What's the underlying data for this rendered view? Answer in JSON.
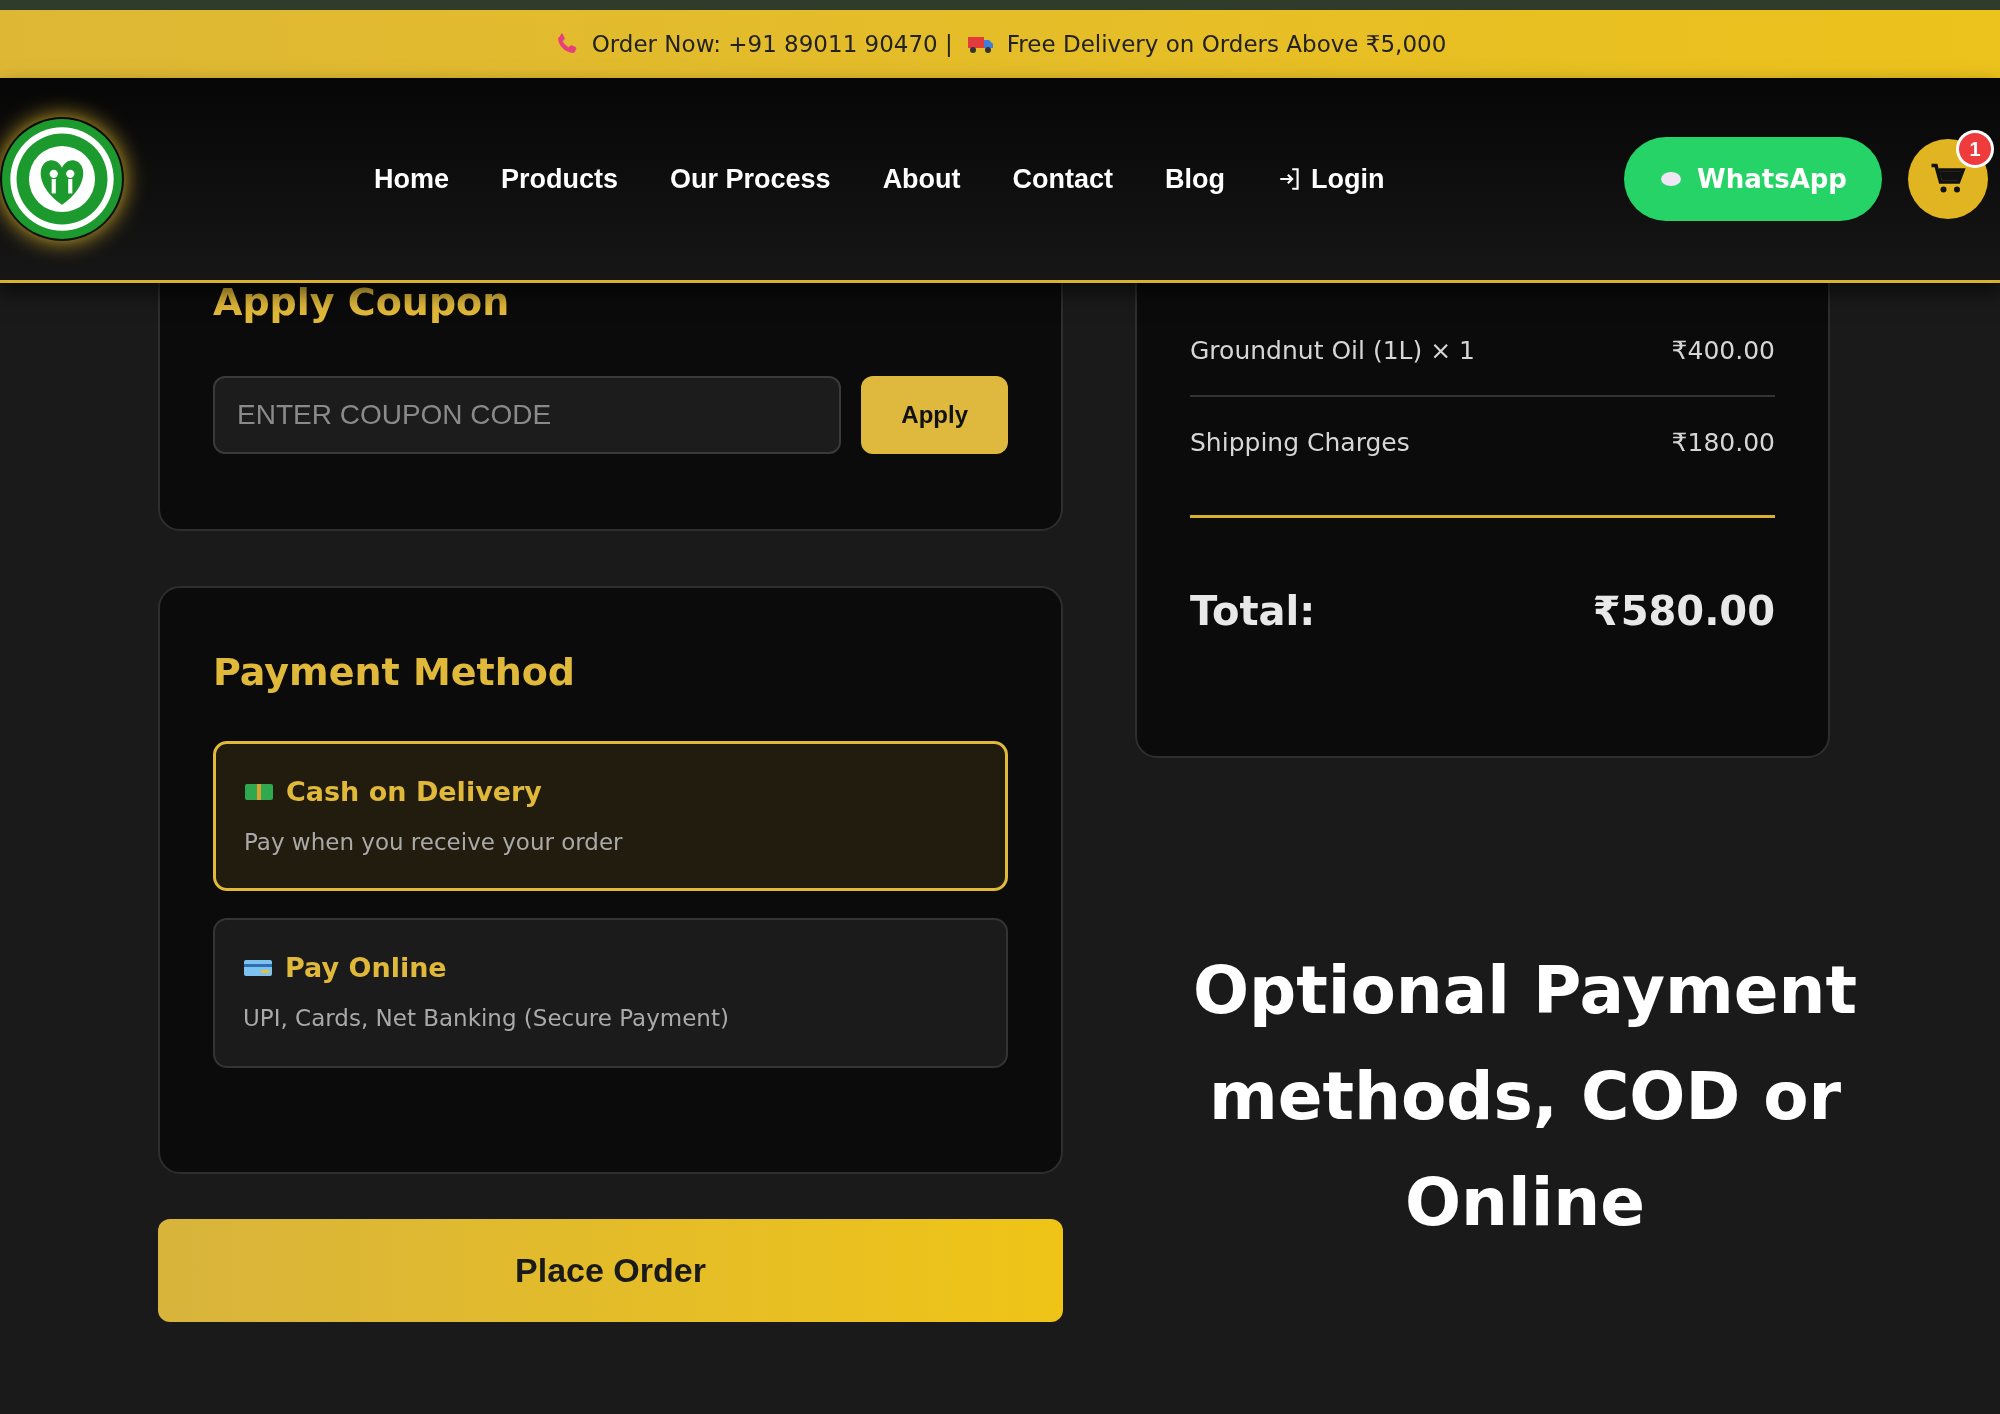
{
  "top_bar": {
    "items": [
      {
        "kind": "phone",
        "text": "Order Now: +91 89011 90470 |"
      },
      {
        "kind": "truck",
        "text": "Free Delivery on Orders Above ₹5,000"
      }
    ]
  },
  "header": {
    "nav": [
      {
        "kind": "link",
        "label": "Home"
      },
      {
        "kind": "link",
        "label": "Products"
      },
      {
        "kind": "link",
        "label": "Our Process"
      },
      {
        "kind": "link",
        "label": "About"
      },
      {
        "kind": "link",
        "label": "Contact"
      },
      {
        "kind": "link",
        "label": "Blog"
      },
      {
        "kind": "login",
        "label": "Login"
      }
    ],
    "whatsapp": "WhatsApp",
    "cart_count": "1"
  },
  "coupon": {
    "title": "Apply Coupon",
    "placeholder": "ENTER COUPON CODE",
    "button": "Apply"
  },
  "payment": {
    "title": "Payment Method",
    "options": [
      {
        "kind": "cash",
        "title": "Cash on Delivery",
        "description": "Pay when you receive your order",
        "selected": true
      },
      {
        "kind": "card",
        "title": "Pay Online",
        "description": "UPI, Cards, Net Banking (Secure Payment)",
        "selected": false
      }
    ]
  },
  "place_order": "Place Order",
  "summary": {
    "items": [
      {
        "name": "Groundnut Oil (1L) × 1",
        "price": "₹400.00"
      },
      {
        "name": "Shipping Charges",
        "price": "₹180.00"
      }
    ],
    "total_label": "Total:",
    "total": "₹580.00"
  },
  "caption": "Optional Payment methods, COD or Online"
}
